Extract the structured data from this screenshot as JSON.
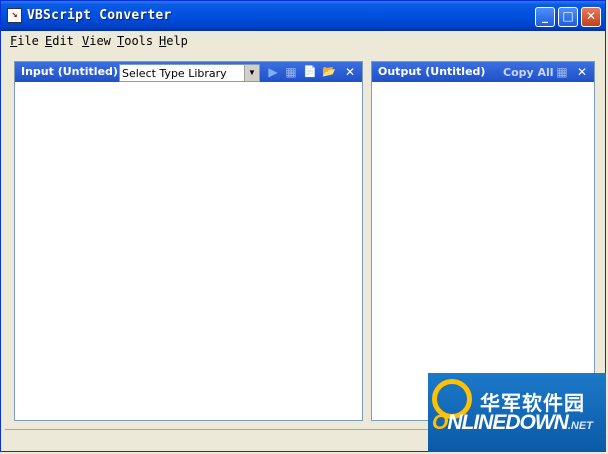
{
  "app": {
    "title": "VBScript Converter",
    "icon_glyph": "↘"
  },
  "window_controls": {
    "minimize_glyph": "_",
    "maximize_glyph": "□",
    "close_glyph": "✕"
  },
  "menu": [
    {
      "underline": "F",
      "rest": "ile"
    },
    {
      "underline": "E",
      "rest": "dit"
    },
    {
      "underline": "V",
      "rest": "iew"
    },
    {
      "underline": "T",
      "rest": "ools"
    },
    {
      "underline": "H",
      "rest": "elp"
    }
  ],
  "input_panel": {
    "title": "Input (Untitled)",
    "type_library": {
      "selected": "Select Type Library",
      "arrow": "▼"
    },
    "toolbar": {
      "run_glyph": "▶",
      "grid_glyph": "▦",
      "new_glyph": "📄",
      "open_glyph": "📂",
      "close_glyph": "✕"
    }
  },
  "output_panel": {
    "title": "Output (Untitled)",
    "copy_all_label": "Copy All",
    "toolbar": {
      "grid_glyph": "▦",
      "close_glyph": "✕"
    }
  },
  "watermark": {
    "chinese": "华军软件园",
    "brand": "NLINEDOWN",
    "suffix": ".NET"
  },
  "colors": {
    "titlebar": "#0050e0",
    "panel_header": "#2a5cd0",
    "chrome": "#ece9d8",
    "watermark_bg": "#1c79c8",
    "watermark_ring": "#ffc100"
  }
}
